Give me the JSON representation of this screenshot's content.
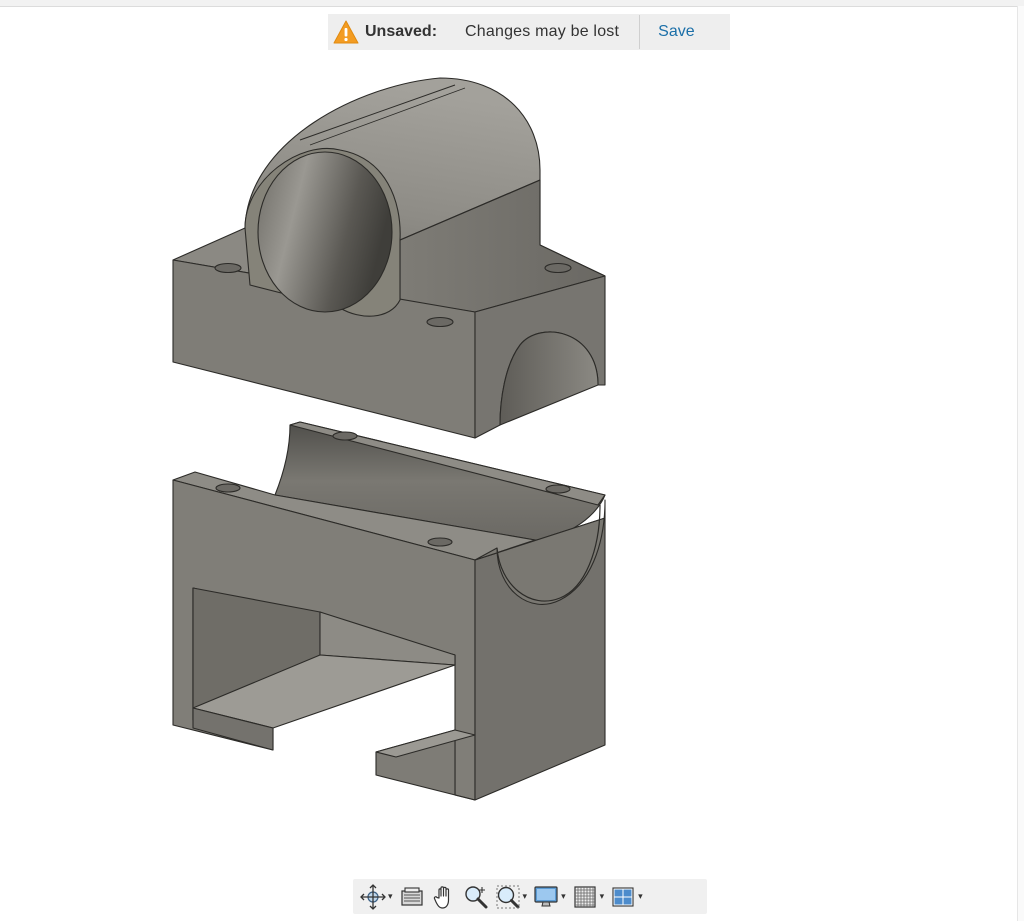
{
  "banner": {
    "label": "Unsaved:",
    "message": "Changes may be lost",
    "save": "Save",
    "icon": "warning-triangle-icon",
    "icon_color": "#f39c22",
    "link_color": "#1b6fa8"
  },
  "viewport": {
    "content": "3D model: two-part shaft clamp block (upper cap with cylindrical bore, lower base with slot)",
    "model_color": "#84827b"
  },
  "toolbar": {
    "items": [
      {
        "name": "orbit",
        "icon": "orbit-icon",
        "has_menu": true
      },
      {
        "name": "look-at",
        "icon": "look-at-icon",
        "has_menu": false
      },
      {
        "name": "pan",
        "icon": "hand-pan-icon",
        "has_menu": false
      },
      {
        "name": "zoom",
        "icon": "zoom-icon",
        "has_menu": false
      },
      {
        "name": "fit",
        "icon": "zoom-window-icon",
        "has_menu": true
      },
      {
        "name": "display-settings",
        "icon": "monitor-icon",
        "has_menu": true
      },
      {
        "name": "grid-settings",
        "icon": "grid-icon",
        "has_menu": true
      },
      {
        "name": "viewports",
        "icon": "viewports-icon",
        "has_menu": true
      }
    ],
    "caret": "▾"
  }
}
